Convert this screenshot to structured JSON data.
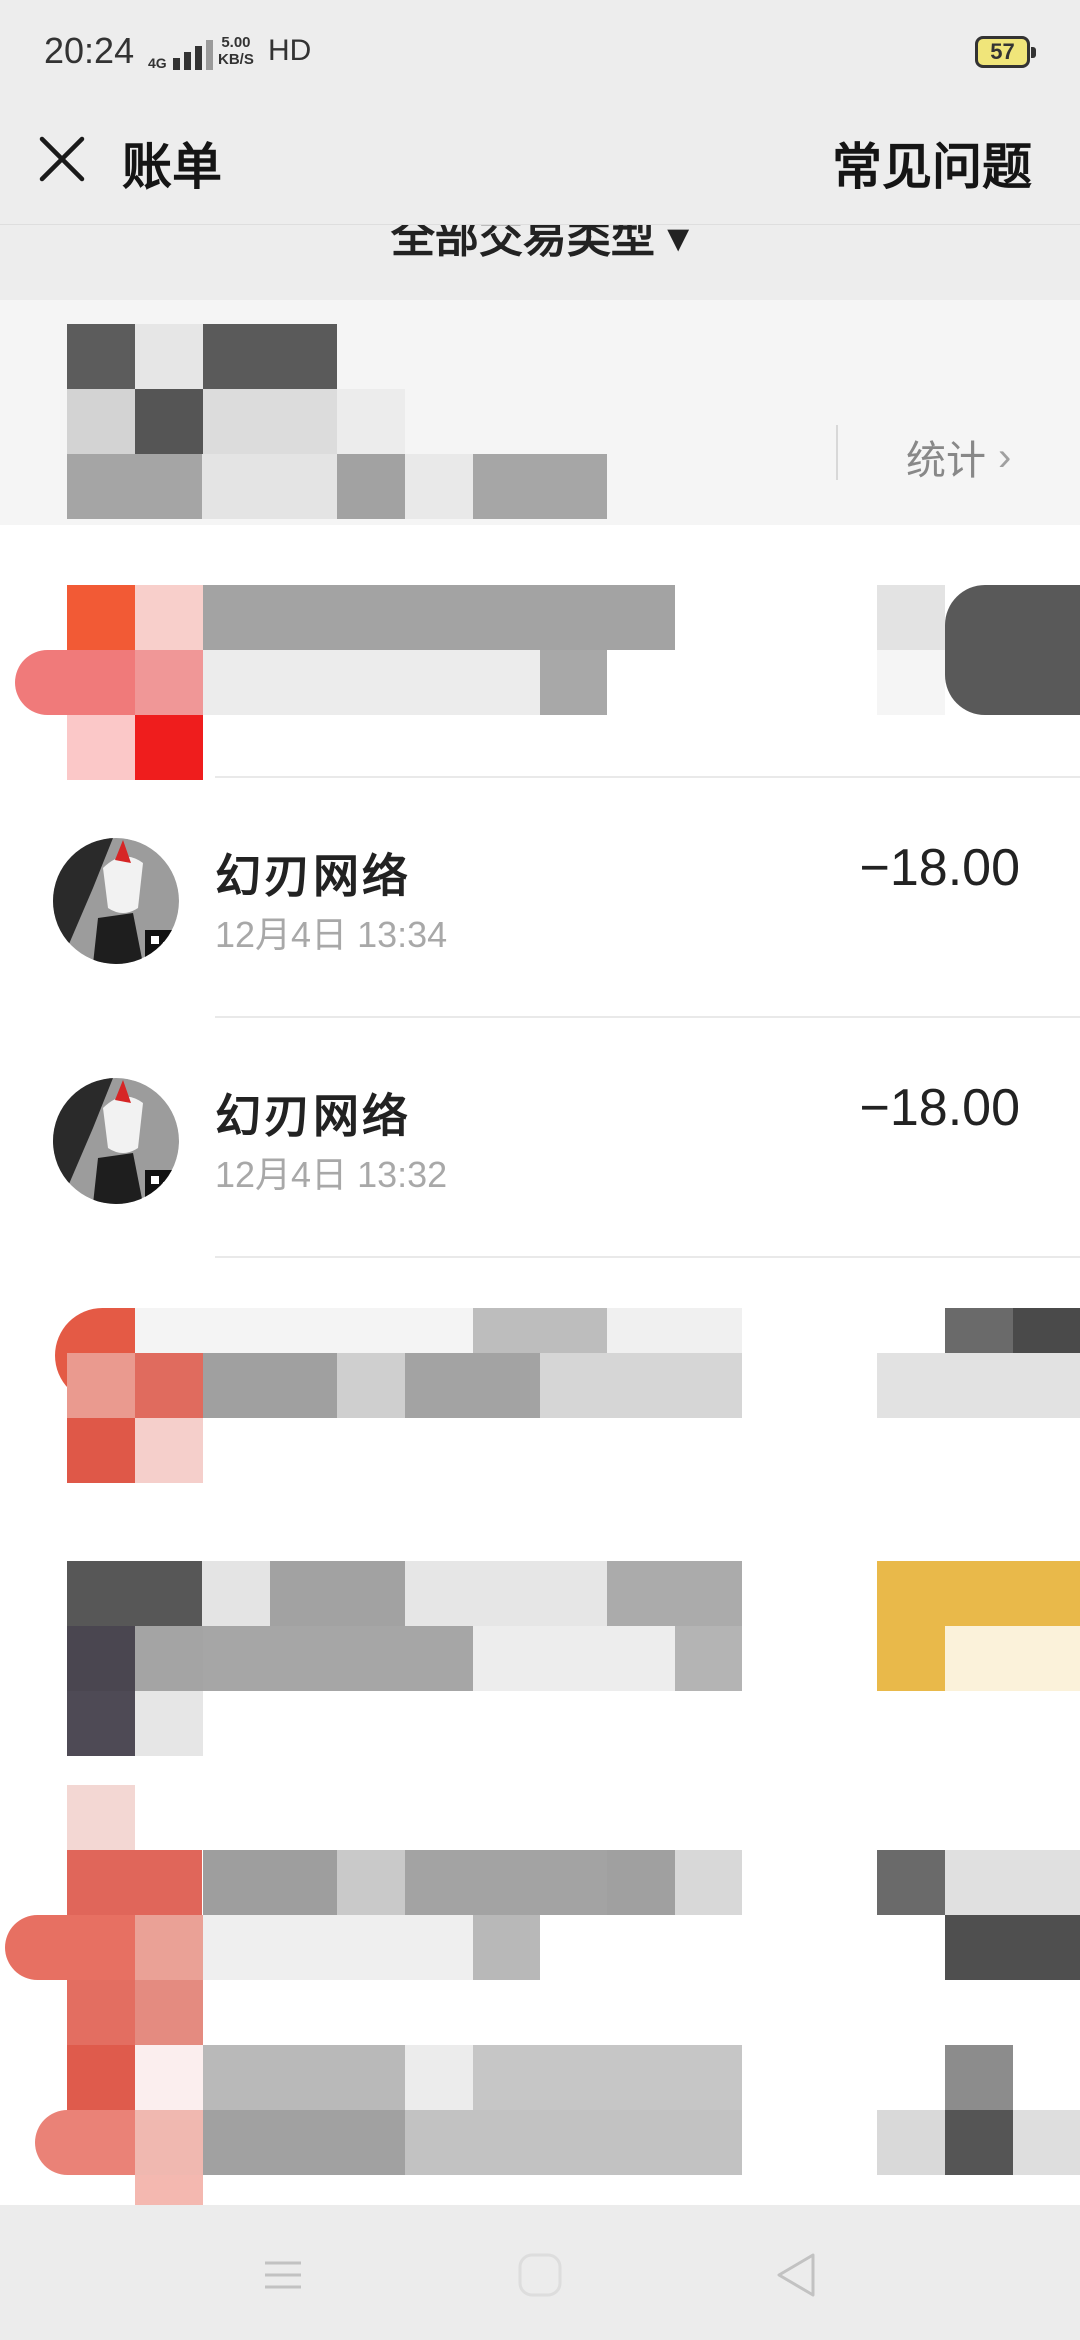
{
  "status_bar": {
    "time": "20:24",
    "network_type": "4G",
    "speed_value": "5.00",
    "speed_unit": "KB/S",
    "hd_label": "HD",
    "battery_level": "57"
  },
  "header": {
    "title": "账单",
    "faq_label": "常见问题"
  },
  "filter": {
    "label": "全部交易类型 ▾"
  },
  "summary": {
    "stats_label": "统计"
  },
  "transactions": [
    {
      "merchant": "幻刃网络",
      "time": "12月4日 13:34",
      "amount": "−18.00"
    },
    {
      "merchant": "幻刃网络",
      "time": "12月4日 13:32",
      "amount": "−18.00"
    }
  ],
  "colors": {
    "background": "#ededed",
    "list_bg": "#ffffff",
    "text_primary": "#1f1f1f",
    "text_secondary": "#a8a8a8"
  },
  "icons": {
    "close": "close-icon",
    "chevron": "chevron-right-icon",
    "nav_menu": "menu-icon",
    "nav_home": "home-icon",
    "nav_back": "back-icon"
  }
}
